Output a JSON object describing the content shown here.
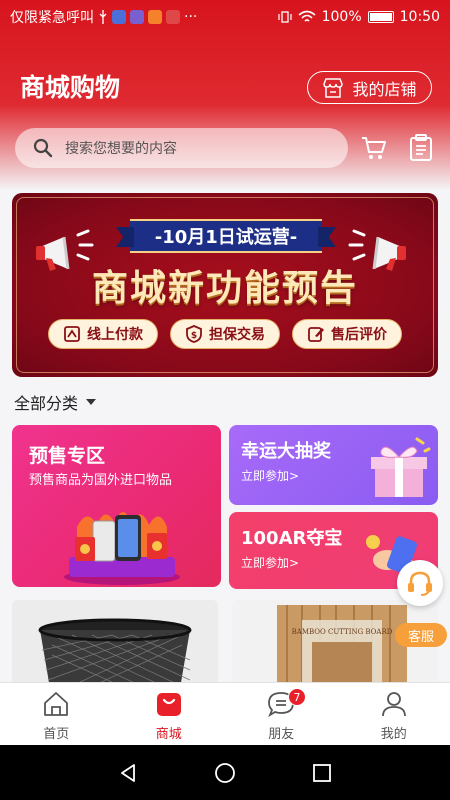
{
  "status_bar": {
    "carrier_text": "仅限紧急呼叫",
    "more": "···",
    "battery": "100%",
    "time": "10:50"
  },
  "header": {
    "title": "商城购物",
    "my_shop_label": "我的店铺"
  },
  "search": {
    "placeholder": "搜索您想要的内容"
  },
  "banner": {
    "ribbon": "-10月1日试运营-",
    "headline": "商城新功能预告",
    "pills": [
      "线上付款",
      "担保交易",
      "售后评价"
    ]
  },
  "category": {
    "label": "全部分类"
  },
  "promos": {
    "presale": {
      "title": "预售专区",
      "subtitle": "预售商品为国外进口物品"
    },
    "lucky": {
      "title": "幸运大抽奖",
      "subtitle": "立即参加>"
    },
    "treasure": {
      "title": "100AR夺宝",
      "subtitle": "立即参加>"
    }
  },
  "product_cards": [
    {
      "image": "wire-mesh-wastebasket"
    },
    {
      "image": "bamboo-cutting-board",
      "box_text": "BAMBOO CUTTING BOARD"
    }
  ],
  "customer_service": {
    "label": "客服"
  },
  "tabs": [
    {
      "label": "首页",
      "icon": "home-icon",
      "active": false
    },
    {
      "label": "商城",
      "icon": "shopping-bag-icon",
      "active": true
    },
    {
      "label": "朋友",
      "icon": "chat-icon",
      "active": false,
      "badge": "7"
    },
    {
      "label": "我的",
      "icon": "user-icon",
      "active": false
    }
  ],
  "colors": {
    "brand_red": "#d7141d",
    "presale_pink": "#ea2a73",
    "lucky_purple": "#8a5cf2",
    "treasure_red": "#f03c75",
    "cs_orange": "#f7a03b"
  }
}
